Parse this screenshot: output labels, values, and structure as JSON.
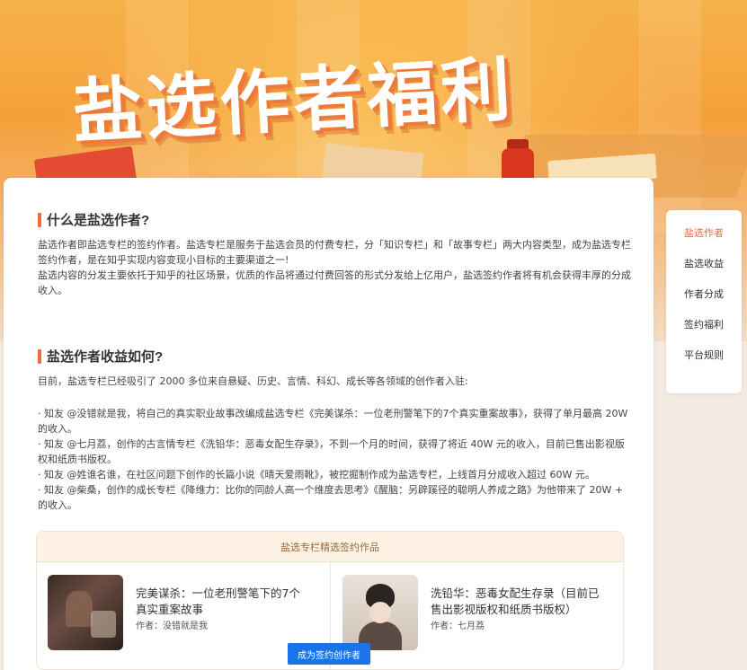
{
  "hero": {
    "title": "盐选作者福利"
  },
  "sections": [
    {
      "title": "什么是盐选作者?",
      "paragraphs": [
        "盐选作者即盐选专栏的签约作者。盐选专栏是服务于盐选会员的付费专栏，分「知识专栏」和「故事专栏」两大内容类型，成为盐选专栏签约作者，是在知乎实现内容变现小目标的主要渠道之一!",
        "盐选内容的分发主要依托于知乎的社区场景，优质的作品将通过付费回答的形式分发给上亿用户，盐选签约作者将有机会获得丰厚的分成收入。"
      ]
    },
    {
      "title": "盐选作者收益如何?",
      "intro": "目前，盐选专栏已经吸引了 2000 多位来自悬疑、历史、言情、科幻、成长等各领域的创作者入驻:",
      "bullets": [
        "· 知友 @没错就是我，将自己的真实职业故事改编成盐选专栏《完美谋杀：一位老刑警笔下的7个真实重案故事》，获得了单月最高 20W 的收入。",
        "· 知友 @七月荔，创作的古言情专栏《洗铅华：恶毒女配生存录》，不到一个月的时间，获得了将近 40W 元的收入，目前已售出影视版权和纸质书版权。",
        "· 知友 @姓谁名谁，在社区问题下创作的长篇小说《晴天爱雨靴》，被挖掘制作成为盐选专栏，上线首月分成收入超过 60W 元。",
        "· 知友 @柴桑，创作的成长专栏《降维力：比你的同龄人高一个维度去思考》《醒脑：另辟蹊径的聪明人养成之路》为他带来了 20W + 的收入。"
      ]
    }
  ],
  "featured": {
    "header": "盐选专栏精选签约作品",
    "works": [
      {
        "title": "完美谋杀：一位老刑警笔下的7个真实重案故事",
        "author": "作者：没错就是我"
      },
      {
        "title": "洗铅华：恶毒女配生存录（目前已售出影视版权和纸质书版权）",
        "author": "作者：七月荔"
      }
    ]
  },
  "cta": {
    "label": "成为签约创作者"
  },
  "sidenav": {
    "items": [
      "盐选作者",
      "盐选收益",
      "作者分成",
      "签约福利",
      "平台规则"
    ],
    "active_index": 0
  },
  "colors": {
    "accent": "#f06a3c",
    "cta_blue": "#1a73e8",
    "featured_header_bg": "#fdf2e4"
  }
}
